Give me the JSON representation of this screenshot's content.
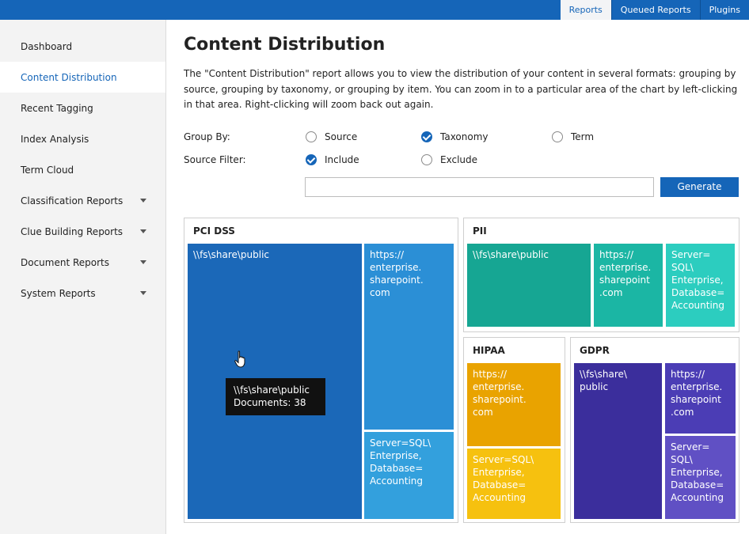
{
  "header": {
    "tabs": [
      {
        "label": "Reports"
      },
      {
        "label": "Queued Reports"
      },
      {
        "label": "Plugins"
      }
    ],
    "active_tab": "Reports",
    "accent_color": "#1565b8"
  },
  "sidebar": {
    "items": [
      {
        "label": "Dashboard"
      },
      {
        "label": "Content Distribution"
      },
      {
        "label": "Recent Tagging"
      },
      {
        "label": "Index Analysis"
      },
      {
        "label": "Term Cloud"
      },
      {
        "label": "Classification Reports"
      },
      {
        "label": "Clue Building Reports"
      },
      {
        "label": "Document Reports"
      },
      {
        "label": "System Reports"
      }
    ],
    "active_item": "Content Distribution"
  },
  "main": {
    "title": "Content Distribution",
    "description": "The \"Content Distribution\" report allows you to view the distribution of your content in several formats: grouping by source, grouping by taxonomy, or grouping by item. You can zoom in to a particular area of the chart by left-clicking in that area. Right-clicking will zoom back out again.",
    "group_by": {
      "label": "Group By:",
      "options": [
        {
          "label": "Source",
          "checked": false
        },
        {
          "label": "Taxonomy",
          "checked": true
        },
        {
          "label": "Term",
          "checked": false
        }
      ]
    },
    "source_filter": {
      "label": "Source Filter:",
      "options": [
        {
          "label": "Include",
          "checked": true
        },
        {
          "label": "Exclude",
          "checked": false
        }
      ],
      "input_value": ""
    },
    "generate_label": "Generate"
  },
  "treemap": {
    "panels": [
      {
        "title": "PCI DSS",
        "cells": [
          {
            "label": "\\\\fs\\share\\public",
            "color": "#1b68b8"
          },
          {
            "label": "https://\nenterprise.\nsharepoint.\ncom",
            "color": "#2b8fd6"
          },
          {
            "label": "Server=SQL\\\nEnterprise,\nDatabase=\nAccounting",
            "color": "#33a0dd"
          }
        ]
      },
      {
        "title": "PII",
        "cells": [
          {
            "label": "\\\\fs\\share\\public",
            "color": "#16a693"
          },
          {
            "label": "https://\nenterprise.\nsharepoint\n.com",
            "color": "#1bb6a4"
          },
          {
            "label": "Server=\nSQL\\\nEnterprise,\nDatabase=\nAccounting",
            "color": "#2ccdbf"
          }
        ]
      },
      {
        "title": "HIPAA",
        "cells": [
          {
            "label": "https://\nenterprise.\nsharepoint.\ncom",
            "color": "#e9a300"
          },
          {
            "label": "Server=SQL\\\nEnterprise,\nDatabase=\nAccounting",
            "color": "#f6c10f"
          }
        ]
      },
      {
        "title": "GDPR",
        "cells": [
          {
            "label": "\\\\fs\\share\\\npublic",
            "color": "#3b2e9c"
          },
          {
            "label": "https://\nenterprise.\nsharepoint\n.com",
            "color": "#4b3db5"
          },
          {
            "label": "Server=\nSQL\\\nEnterprise,\nDatabase=\nAccounting",
            "color": "#6050c4"
          }
        ]
      }
    ],
    "tooltip": {
      "line1": "\\\\fs\\share\\public",
      "line2": "Documents: 38"
    }
  }
}
